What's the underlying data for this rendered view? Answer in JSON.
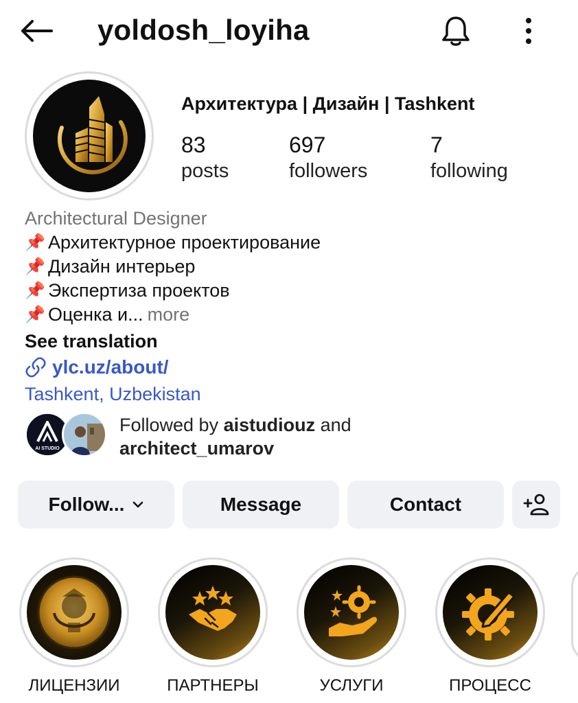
{
  "header": {
    "username": "yoldosh_loyiha",
    "back_icon": "arrow-left-icon",
    "notify_icon": "bell-icon",
    "menu_icon": "vertical-dots-icon"
  },
  "profile": {
    "category": "Архитектура | Дизайн | Tashkent",
    "stats": {
      "posts": {
        "value": "83",
        "label": "posts"
      },
      "followers": {
        "value": "697",
        "label": "followers"
      },
      "following": {
        "value": "7",
        "label": "following"
      }
    },
    "bio": {
      "role": "Architectural Designer",
      "lines": [
        "Архитектурное проектирование",
        "Дизайн интерьер",
        "Экспертиза проектов",
        "Оценка и..."
      ],
      "pin_glyph": "📌",
      "more_label": "more",
      "see_translation": "See translation",
      "link": "ylc.uz/about/",
      "location": "Tashkent, Uzbekistan"
    },
    "followed_by": {
      "prefix": "Followed by ",
      "user1": "aistudiouz",
      "joiner": " and",
      "user2": "architect_umarov",
      "avatar1_text": "AI STUDIO"
    }
  },
  "actions": {
    "follow_label": "Follow...",
    "message_label": "Message",
    "contact_label": "Contact",
    "add_user_icon": "add-user-icon"
  },
  "highlights": [
    {
      "label": "ЛИЦЕНЗИИ",
      "icon": "emblem-icon"
    },
    {
      "label": "ПАРТНЕРЫ",
      "icon": "handshake-icon"
    },
    {
      "label": "УСЛУГИ",
      "icon": "hand-gear-icon"
    },
    {
      "label": "ПРОЦЕСС",
      "icon": "gear-pencil-icon"
    }
  ],
  "colors": {
    "link_blue": "#3858c9",
    "button_bg": "#eff1f4",
    "gold": "#e0a526",
    "muted": "#737373"
  }
}
